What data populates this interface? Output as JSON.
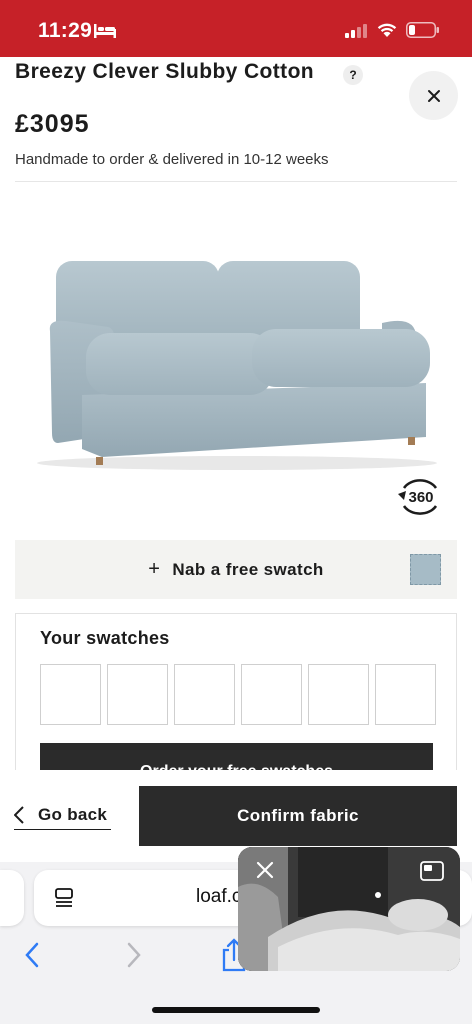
{
  "status_bar": {
    "time": "11:29",
    "background_color": "#c62128"
  },
  "product": {
    "title": "Breezy Clever Slubby Cotton",
    "help_label": "?",
    "price": "£3095",
    "delivery_note": "Handmade to order & delivered in 10-12 weeks",
    "rotate_label": "360",
    "fabric_color": "#a6bbc6"
  },
  "free_swatch": {
    "plus": "+",
    "label": "Nab a free swatch"
  },
  "swatches": {
    "heading": "Your swatches",
    "order_button_label": "Order your free swatches"
  },
  "footer": {
    "go_back_label": "Go back",
    "confirm_label": "Confirm fabric"
  },
  "browser": {
    "url": "loaf.c"
  }
}
